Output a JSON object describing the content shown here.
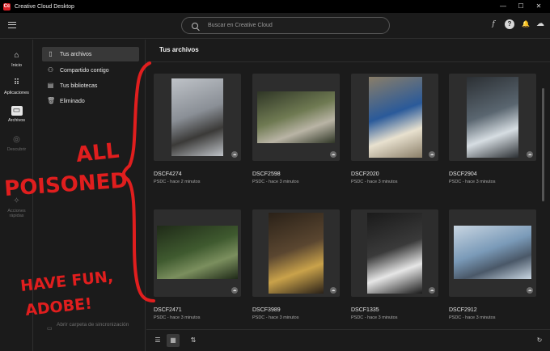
{
  "window": {
    "title": "Creative Cloud Desktop",
    "controls": [
      "—",
      "☐",
      "✕"
    ]
  },
  "search": {
    "placeholder": "Buscar en Creative Cloud"
  },
  "topbar_icons": [
    "f",
    "?",
    "🔔",
    "☁"
  ],
  "leftnav": {
    "items": [
      {
        "label": "Inicio",
        "icon": "home-icon",
        "glyph": "⌂"
      },
      {
        "label": "Aplicaciones",
        "icon": "apps-grid-icon",
        "glyph": "⠿"
      },
      {
        "label": "Archivos",
        "icon": "files-icon",
        "glyph": "▭"
      },
      {
        "label": "Descubrir",
        "icon": "discover-icon",
        "glyph": "◎"
      },
      {
        "label": "Acciones rápidas",
        "icon": "quick-actions-icon",
        "glyph": "✧"
      }
    ]
  },
  "panel": {
    "items": [
      {
        "label": "Tus archivos",
        "icon": "file-icon",
        "glyph": "▯"
      },
      {
        "label": "Compartido contigo",
        "icon": "shared-icon",
        "glyph": "⚇"
      },
      {
        "label": "Tus bibliotecas",
        "icon": "libraries-icon",
        "glyph": "▤"
      },
      {
        "label": "Eliminado",
        "icon": "trash-icon",
        "glyph": "🗑"
      }
    ],
    "sync_label": "Abrir carpeta de sincronización"
  },
  "main": {
    "title": "Tus archivos",
    "files": [
      {
        "name": "DSCF4274",
        "meta": "PSDC - hace 2 minutos",
        "colors": [
          "#8a8f96",
          "#3b3a38",
          "#bfc3c8"
        ]
      },
      {
        "name": "DSCF2598",
        "meta": "PSDC - hace 3 minutos",
        "colors": [
          "#6f7a52",
          "#b9b4a5",
          "#2f3626"
        ]
      },
      {
        "name": "DSCF2020",
        "meta": "PSDC - hace 3 minutos",
        "colors": [
          "#2a5a9a",
          "#e8e1cf",
          "#8a7e68"
        ]
      },
      {
        "name": "DSCF2904",
        "meta": "PSDC - hace 3 minutos",
        "colors": [
          "#5a6670",
          "#d6dde2",
          "#2b2f33"
        ]
      },
      {
        "name": "DSCF2471",
        "meta": "PSDC - hace 3 minutos",
        "colors": [
          "#3f5a2f",
          "#7b8f5e",
          "#1f2a18"
        ]
      },
      {
        "name": "DSCF3989",
        "meta": "PSDC - hace 3 minutos",
        "colors": [
          "#5a4630",
          "#c9a24a",
          "#2a2118"
        ]
      },
      {
        "name": "DSCF1335",
        "meta": "PSDC - hace 3 minutos",
        "colors": [
          "#3a3a3a",
          "#e6e6e6",
          "#1a1a1a"
        ]
      },
      {
        "name": "DSCF2912",
        "meta": "PSDC - hace 3 minutos",
        "colors": [
          "#7a9ab8",
          "#4a5868",
          "#c9d6e2"
        ]
      }
    ]
  },
  "annotation": {
    "line1": "ALL",
    "line2": "POISONED",
    "line3": "HAVE FUN,",
    "line4": "ADOBE!",
    "color": "#e01e1e"
  }
}
